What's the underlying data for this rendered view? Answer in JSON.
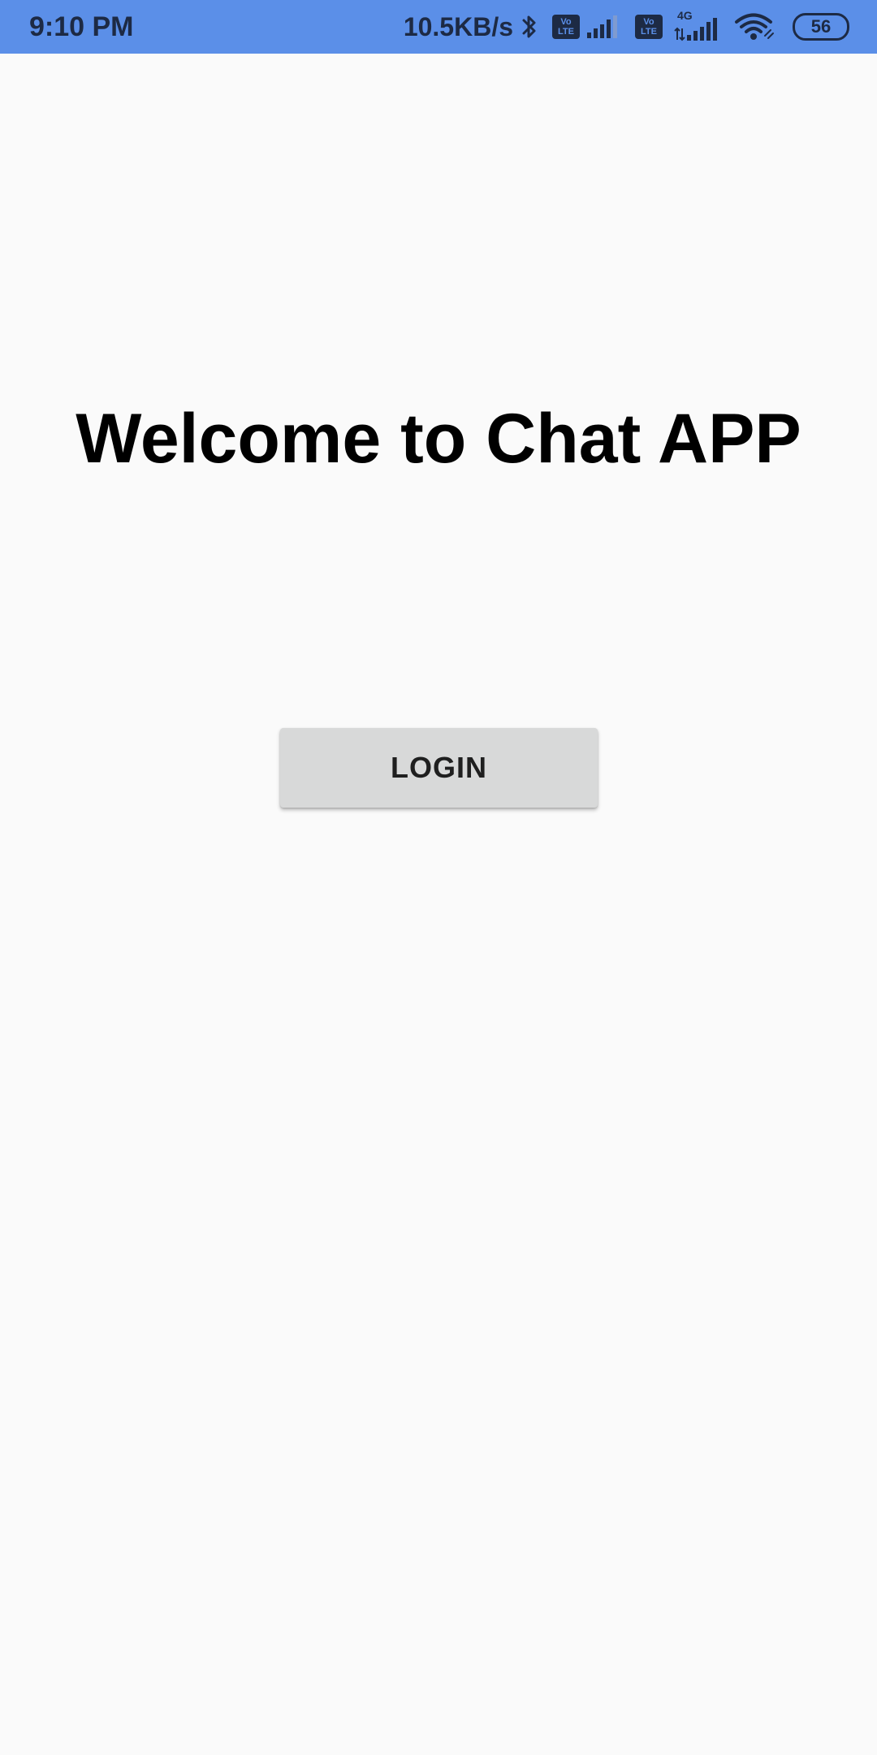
{
  "status_bar": {
    "time": "9:10 PM",
    "net_speed": "10.5KB/s",
    "volte_label_top": "Vo",
    "volte_label_bottom": "LTE",
    "network_type": "4G",
    "battery_level": "56",
    "background_color": "#5b8fe8",
    "icons": [
      "bluetooth-icon",
      "volte-icon",
      "signal-icon",
      "volte-icon",
      "signal-4g-icon",
      "wifi-icon",
      "battery-icon"
    ]
  },
  "main": {
    "title": "Welcome to Chat APP",
    "login_label": "LOGIN"
  }
}
